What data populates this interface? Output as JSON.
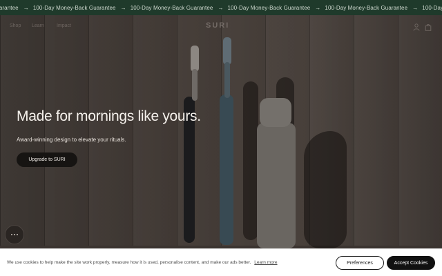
{
  "announcement": {
    "items": [
      "Guarantee",
      "100-Day Money-Back Guarantee",
      "100-Day Money-Back Guarantee",
      "100-Day Money-Back Guarantee",
      "100-Day Money-Back Guarantee",
      "100-Day Money-Back Guarantee"
    ],
    "separator": "→",
    "background": "#1f3a2b"
  },
  "nav": {
    "links": [
      "Shop",
      "Learn",
      "Impact"
    ],
    "logo": "SURI",
    "icons": [
      "account-icon",
      "cart-icon"
    ]
  },
  "hero": {
    "headline": "Made for mornings like yours.",
    "subline": "Award-winning design to elevate your rituals.",
    "cta_label": "Upgrade to SURI"
  },
  "chat": {
    "icon": "chat-bubble-icon"
  },
  "cookie_banner": {
    "text": "We use cookies to help make the site work properly, measure how it is used, personalise content, and make our ads better.",
    "link_label": "Learn more",
    "preferences_label": "Preferences",
    "accept_label": "Accept Cookies"
  }
}
